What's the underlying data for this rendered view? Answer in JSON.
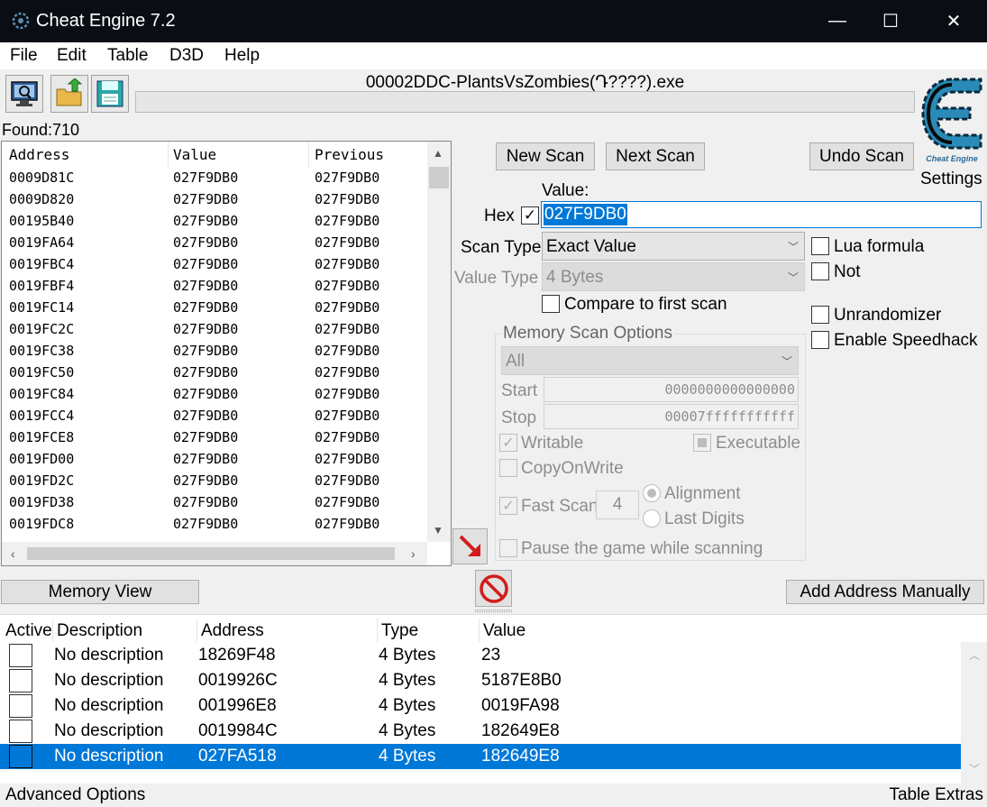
{
  "window": {
    "title": "Cheat Engine 7.2",
    "minimize": "—",
    "maximize": "☐",
    "close": "✕"
  },
  "menu": [
    "File",
    "Edit",
    "Table",
    "D3D",
    "Help"
  ],
  "process_title": "00002DDC-PlantsVsZombies(Դ????).exe",
  "found": "Found:710",
  "settings_label": "Settings",
  "results": {
    "columns": [
      "Address",
      "Value",
      "Previous"
    ],
    "rows": [
      [
        "0009D81C",
        "027F9DB0",
        "027F9DB0"
      ],
      [
        "0009D820",
        "027F9DB0",
        "027F9DB0"
      ],
      [
        "00195B40",
        "027F9DB0",
        "027F9DB0"
      ],
      [
        "0019FA64",
        "027F9DB0",
        "027F9DB0"
      ],
      [
        "0019FBC4",
        "027F9DB0",
        "027F9DB0"
      ],
      [
        "0019FBF4",
        "027F9DB0",
        "027F9DB0"
      ],
      [
        "0019FC14",
        "027F9DB0",
        "027F9DB0"
      ],
      [
        "0019FC2C",
        "027F9DB0",
        "027F9DB0"
      ],
      [
        "0019FC38",
        "027F9DB0",
        "027F9DB0"
      ],
      [
        "0019FC50",
        "027F9DB0",
        "027F9DB0"
      ],
      [
        "0019FC84",
        "027F9DB0",
        "027F9DB0"
      ],
      [
        "0019FCC4",
        "027F9DB0",
        "027F9DB0"
      ],
      [
        "0019FCE8",
        "027F9DB0",
        "027F9DB0"
      ],
      [
        "0019FD00",
        "027F9DB0",
        "027F9DB0"
      ],
      [
        "0019FD2C",
        "027F9DB0",
        "027F9DB0"
      ],
      [
        "0019FD38",
        "027F9DB0",
        "027F9DB0"
      ],
      [
        "0019FDC8",
        "027F9DB0",
        "027F9DB0"
      ]
    ]
  },
  "scan": {
    "new_scan": "New Scan",
    "next_scan": "Next Scan",
    "undo_scan": "Undo Scan",
    "value_label": "Value:",
    "hex_label": "Hex",
    "value": "027F9DB0",
    "scan_type_label": "Scan Type",
    "scan_type": "Exact Value",
    "value_type_label": "Value Type",
    "value_type": "4 Bytes",
    "compare_first": "Compare to first scan",
    "lua_formula": "Lua formula",
    "not": "Not",
    "unrandomizer": "Unrandomizer",
    "speedhack": "Enable Speedhack"
  },
  "memory_options": {
    "title": "Memory Scan Options",
    "region": "All",
    "start_label": "Start",
    "start": "0000000000000000",
    "stop_label": "Stop",
    "stop": "00007fffffffffff",
    "writable": "Writable",
    "executable": "Executable",
    "copy_on_write": "CopyOnWrite",
    "fast_scan": "Fast Scan",
    "fast_scan_value": "4",
    "alignment": "Alignment",
    "last_digits": "Last Digits",
    "pause_game": "Pause the game while scanning"
  },
  "memory_view": "Memory View",
  "add_address": "Add Address Manually",
  "address_table": {
    "columns": [
      "Active",
      "Description",
      "Address",
      "Type",
      "Value"
    ],
    "rows": [
      [
        "No description",
        "18269F48",
        "4 Bytes",
        "23"
      ],
      [
        "No description",
        "0019926C",
        "4 Bytes",
        "5187E8B0"
      ],
      [
        "No description",
        "001996E8",
        "4 Bytes",
        "0019FA98"
      ],
      [
        "No description",
        "0019984C",
        "4 Bytes",
        "182649E8"
      ],
      [
        "No description",
        "027FA518",
        "4 Bytes",
        "182649E8"
      ]
    ]
  },
  "status": {
    "left": "Advanced Options",
    "right": "Table Extras"
  }
}
